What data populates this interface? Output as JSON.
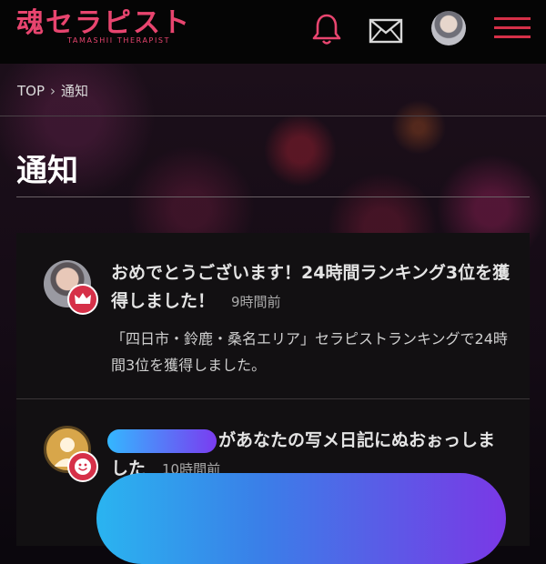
{
  "header": {
    "logo_text": "魂セラピスト",
    "logo_sub": "TAMASHII THERAPIST",
    "icons": [
      "bell-icon",
      "mail-icon",
      "avatar",
      "hamburger-menu-icon"
    ],
    "accent_color": "#e8456f"
  },
  "breadcrumb": {
    "home": "TOP",
    "separator": "›",
    "current": "通知"
  },
  "page_title": "通知",
  "notifications": [
    {
      "title": "おめでとうございます！24時間ランキング3位を獲得しました！",
      "time": "9時間前",
      "body": "「四日市・鈴鹿・桑名エリア」セラピストランキングで24時間3位を獲得しました。",
      "badge_icon": "crown-icon"
    },
    {
      "title": "があなたの写メ日記にぬおぉっしました",
      "time": "10時間前",
      "badge_icon": "smile-icon"
    }
  ]
}
